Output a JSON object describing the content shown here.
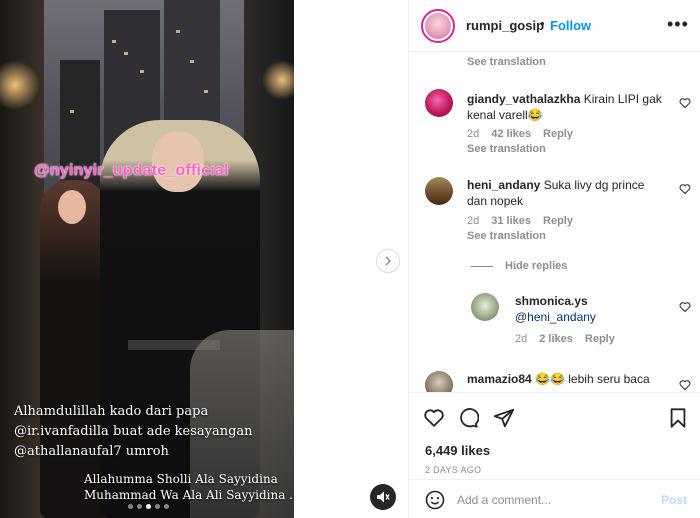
{
  "media": {
    "watermark": "@nyinyir_update_official",
    "caption_line1": "Alhamdulillah kado dari papa",
    "caption_line2": "@ir.ivanfadilla buat ade kesayangan",
    "caption_line3": "@athallanaufal7 umroh",
    "caption_line4": "Allahumma Sholli Ala Sayyidina",
    "caption_line5": "Muhammad Wa Ala Ali Sayyidina ...",
    "carousel_dots": 5,
    "carousel_active": 2,
    "next_icon": "chevron-right-icon",
    "mute_icon": "speaker-muted-icon"
  },
  "header": {
    "username": "rumpi_gosip",
    "separator": "•",
    "follow_label": "Follow",
    "more_label": "•••"
  },
  "comments": {
    "top_see_translation": "See translation",
    "items": [
      {
        "username": "giandy_vathalazkha",
        "text": "Kirain LIPI gak kenal varell😂",
        "age": "2d",
        "likes": "42 likes",
        "reply": "Reply",
        "see_translation": "See translation",
        "avatar_color": "#c2185b"
      },
      {
        "username": "heni_andany",
        "text": "Suka livy dg prince dan nopek",
        "age": "2d",
        "likes": "31 likes",
        "reply": "Reply",
        "see_translation": "See translation",
        "avatar_color": "#6b4a2a"
      }
    ],
    "hide_replies": "Hide replies",
    "reply_item": {
      "username": "shmonica.ys",
      "text": "@heni_andany",
      "age": "2d",
      "likes": "2 likes",
      "reply": "Reply",
      "avatar_color": "#7d8f6a"
    },
    "last_item": {
      "username": "mamazio84",
      "text": "😂😂 lebih seru baca"
    }
  },
  "actions": {
    "like_icon": "heart-icon",
    "comment_icon": "comment-icon",
    "share_icon": "send-icon",
    "save_icon": "bookmark-icon",
    "likes_count": "6,449 likes",
    "date": "2 DAYS AGO"
  },
  "add_comment": {
    "placeholder": "Add a comment...",
    "value": "",
    "post_label": "Post",
    "emoji_icon": "emoji-icon"
  },
  "colors": {
    "accent": "#0095f6",
    "watermark": "#ff63c8",
    "muted_text": "#8e8e8e",
    "post_disabled": "#b2dffc"
  }
}
